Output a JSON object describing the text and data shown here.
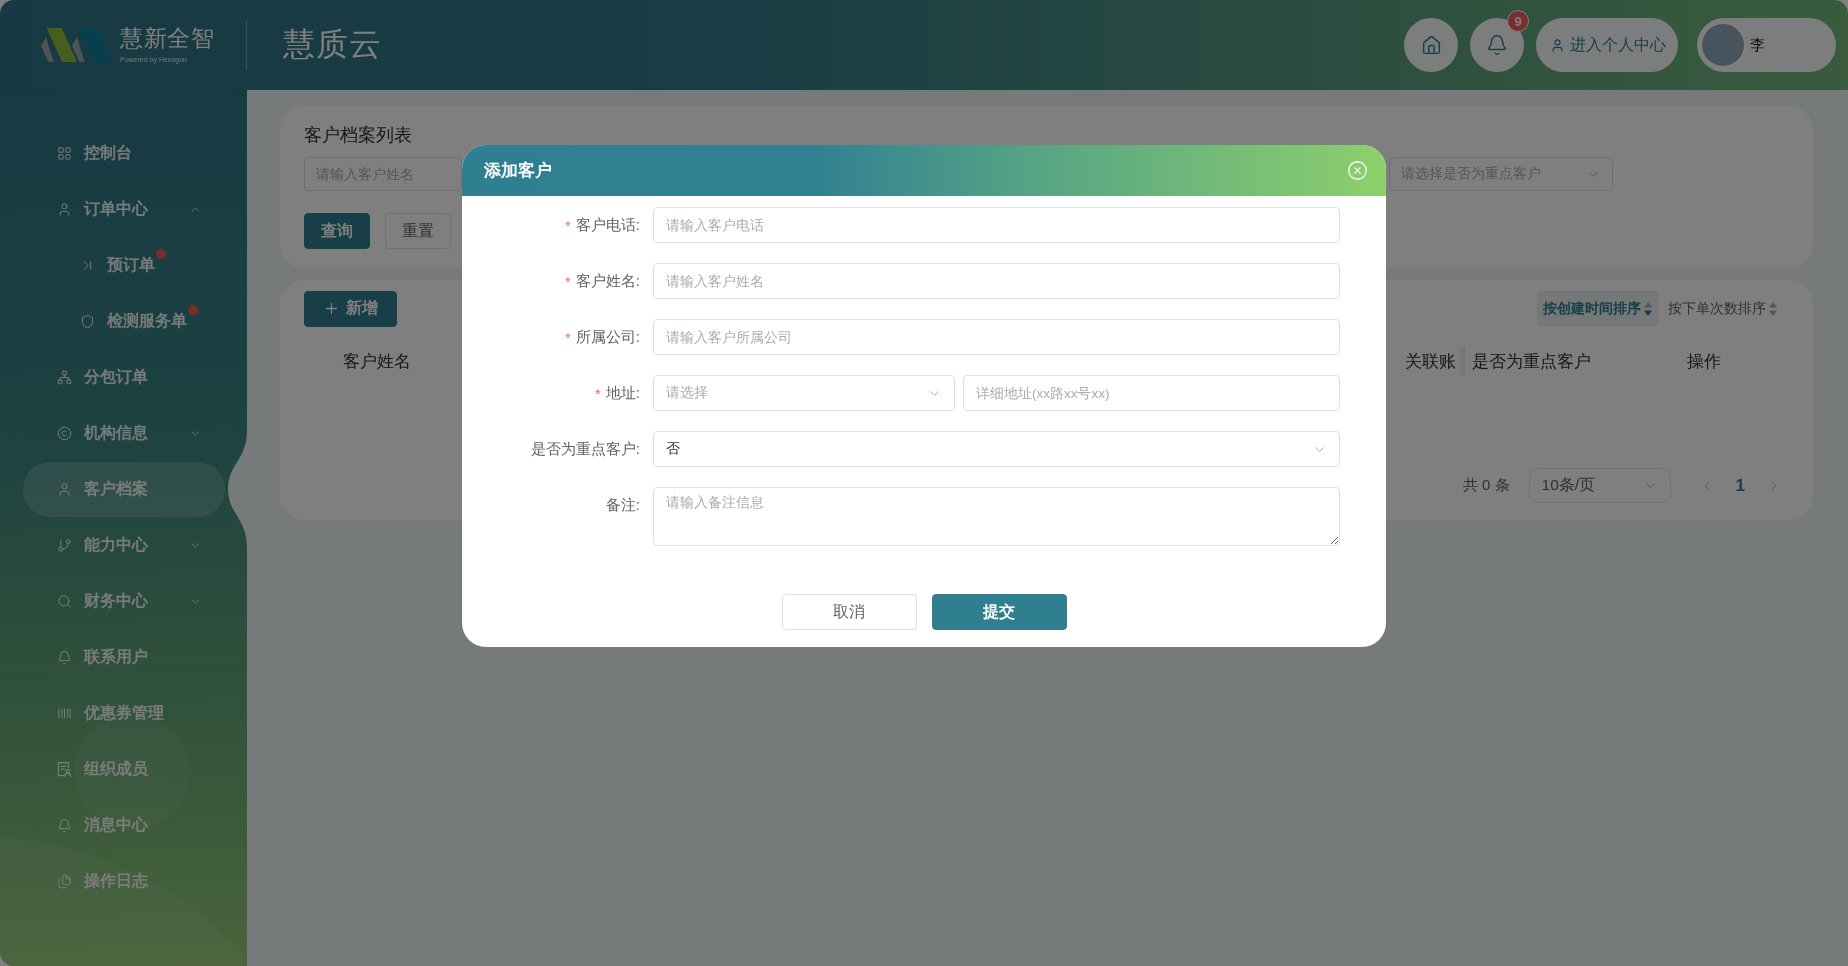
{
  "header": {
    "brand": {
      "name": "慧新全智",
      "tagline": "Powered by Hexagon"
    },
    "app_title": "慧质云",
    "notification_count": "9",
    "profile_button": "进入个人中心",
    "user_name": "李"
  },
  "sidebar": {
    "items": [
      {
        "kind": "link",
        "label": "控制台",
        "selected": false
      },
      {
        "kind": "group",
        "label": "订单中心",
        "selected": false,
        "expanded": true,
        "children": [
          {
            "label": "预订单",
            "selected": false,
            "dot": true
          },
          {
            "label": "检测服务单",
            "selected": false,
            "dot": true
          }
        ]
      },
      {
        "kind": "link",
        "label": "分包订单",
        "selected": false
      },
      {
        "kind": "group",
        "label": "机构信息",
        "selected": false,
        "expanded": false
      },
      {
        "kind": "link",
        "label": "客户档案",
        "selected": true
      },
      {
        "kind": "group",
        "label": "能力中心",
        "selected": false,
        "expanded": false
      },
      {
        "kind": "group",
        "label": "财务中心",
        "selected": false,
        "expanded": false
      },
      {
        "kind": "link",
        "label": "联系用户",
        "selected": false
      },
      {
        "kind": "link",
        "label": "优惠券管理",
        "selected": false
      },
      {
        "kind": "link",
        "label": "组织成员",
        "selected": false
      },
      {
        "kind": "link",
        "label": "消息中心",
        "selected": false
      },
      {
        "kind": "link",
        "label": "操作日志",
        "selected": false
      }
    ]
  },
  "filter_card": {
    "title": "客户档案列表",
    "name_input": {
      "placeholder": "请输入客户姓名"
    },
    "key_customer_select": {
      "placeholder": "请选择是否为重点客户"
    },
    "buttons": [
      {
        "kind": "primary",
        "label": "查询"
      },
      {
        "kind": "secondary",
        "label": "重置"
      }
    ]
  },
  "list_card": {
    "add_button": "新增",
    "sort_buttons": [
      {
        "label": "按创建时间排序",
        "selected": true
      },
      {
        "label": "按下单次数排序",
        "selected": false
      }
    ],
    "columns": [
      {
        "label": "客户姓名"
      },
      {
        "label": "关联账"
      },
      {
        "label": "是否为重点客户"
      },
      {
        "label": "操作"
      }
    ],
    "pagination": {
      "total": "共 0 条",
      "page_size": "10条/页",
      "pages": [
        {
          "label": "1",
          "selected": true
        }
      ]
    }
  },
  "dialog": {
    "title": "添加客户",
    "fields": [
      {
        "kind": "input",
        "required_mark": "*",
        "label": "客户电话:",
        "placeholder": "请输入客户电话"
      },
      {
        "kind": "input",
        "required_mark": "*",
        "label": "客户姓名:",
        "placeholder": "请输入客户姓名"
      },
      {
        "kind": "input",
        "required_mark": "*",
        "label": "所属公司:",
        "placeholder": "请输入客户所属公司"
      },
      {
        "kind": "address",
        "required_mark": "*",
        "label": "地址:",
        "parts": [
          {
            "kind": "select",
            "placeholder": "请选择"
          },
          {
            "kind": "input",
            "placeholder": "详细地址(xx路xx号xx)"
          }
        ]
      },
      {
        "kind": "select",
        "label": "是否为重点客户:",
        "value": "否"
      },
      {
        "kind": "textarea",
        "label": "备注:",
        "placeholder": "请输入备注信息"
      }
    ],
    "buttons": [
      {
        "kind": "secondary",
        "label": "取消"
      },
      {
        "kind": "primary",
        "label": "提交"
      }
    ]
  }
}
